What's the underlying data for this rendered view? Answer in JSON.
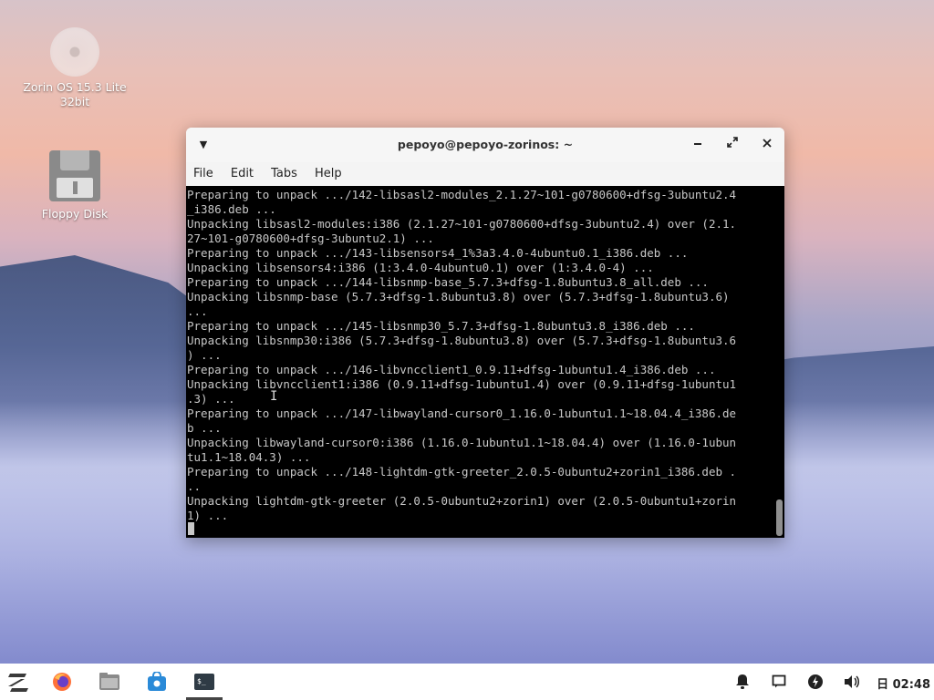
{
  "desktop": {
    "icons": [
      {
        "label_line1": "Zorin OS 15.3 Lite",
        "label_line2": "32bit",
        "icon": "disc-icon"
      },
      {
        "label_line1": "Floppy Disk",
        "icon": "floppy-disk-icon"
      }
    ]
  },
  "window": {
    "title": "pepoyo@pepoyo-zorinos: ~",
    "menu": [
      "File",
      "Edit",
      "Tabs",
      "Help"
    ],
    "terminal_lines": [
      "Preparing to unpack .../142-libsasl2-modules_2.1.27~101-g0780600+dfsg-3ubuntu2.4",
      "_i386.deb ...",
      "Unpacking libsasl2-modules:i386 (2.1.27~101-g0780600+dfsg-3ubuntu2.4) over (2.1.",
      "27~101-g0780600+dfsg-3ubuntu2.1) ...",
      "Preparing to unpack .../143-libsensors4_1%3a3.4.0-4ubuntu0.1_i386.deb ...",
      "Unpacking libsensors4:i386 (1:3.4.0-4ubuntu0.1) over (1:3.4.0-4) ...",
      "Preparing to unpack .../144-libsnmp-base_5.7.3+dfsg-1.8ubuntu3.8_all.deb ...",
      "Unpacking libsnmp-base (5.7.3+dfsg-1.8ubuntu3.8) over (5.7.3+dfsg-1.8ubuntu3.6)",
      "...",
      "Preparing to unpack .../145-libsnmp30_5.7.3+dfsg-1.8ubuntu3.8_i386.deb ...",
      "Unpacking libsnmp30:i386 (5.7.3+dfsg-1.8ubuntu3.8) over (5.7.3+dfsg-1.8ubuntu3.6",
      ") ...",
      "Preparing to unpack .../146-libvncclient1_0.9.11+dfsg-1ubuntu1.4_i386.deb ...",
      "Unpacking libvncclient1:i386 (0.9.11+dfsg-1ubuntu1.4) over (0.9.11+dfsg-1ubuntu1",
      ".3) ...",
      "Preparing to unpack .../147-libwayland-cursor0_1.16.0-1ubuntu1.1~18.04.4_i386.de",
      "b ...",
      "Unpacking libwayland-cursor0:i386 (1.16.0-1ubuntu1.1~18.04.4) over (1.16.0-1ubun",
      "tu1.1~18.04.3) ...",
      "Preparing to unpack .../148-lightdm-gtk-greeter_2.0.5-0ubuntu2+zorin1_i386.deb .",
      "..",
      "Unpacking lightdm-gtk-greeter (2.0.5-0ubuntu2+zorin1) over (2.0.5-0ubuntu1+zorin",
      "1) ..."
    ]
  },
  "taskbar": {
    "apps": [
      "zorin-menu-icon",
      "firefox-icon",
      "files-icon",
      "software-store-icon",
      "terminal-icon"
    ],
    "tray": [
      "bell-icon",
      "message-icon",
      "power-icon",
      "volume-icon"
    ],
    "clock": "02:48",
    "clock_prefix": "日"
  },
  "colors": {
    "terminal_bg": "#000000",
    "terminal_fg": "#c8c8c8",
    "firefox": "#ff7139",
    "store": "#2a8ad8"
  }
}
